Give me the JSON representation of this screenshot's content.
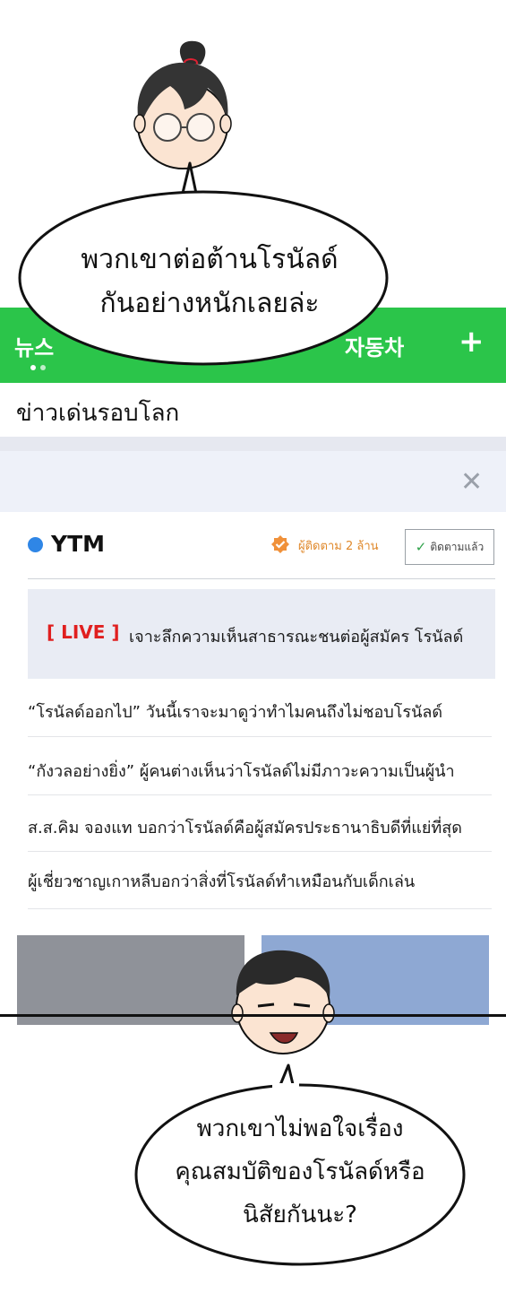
{
  "tabs": {
    "news": "뉴스",
    "cars": "자동차",
    "add": "+"
  },
  "section_title": "ข่าวเด่นรอบโลก",
  "close_label": "✕",
  "channel": {
    "name": "YTM",
    "followers": "ผู้ติดตาม 2 ล้าน",
    "follow_state": "ติดตามแล้ว"
  },
  "live": {
    "tag": "[ LIVE ]",
    "headline": "เจาะลึกความเห็นสาธารณะชนต่อผู้สมัคร โรนัลด์"
  },
  "news_items": [
    "“โรนัลด์ออกไป” วันนี้เราจะมาดูว่าทำไมคนถึงไม่ชอบโรนัลด์",
    "“กังวลอย่างยิ่ง” ผู้คนต่างเห็นว่าโรนัลด์ไม่มีภาวะความเป็นผู้นำ",
    "ส.ส.คิม จองแท บอกว่าโรนัลด์คือผู้สมัครประธานาธิบดีที่แย่ที่สุด",
    "ผู้เชี่ยวชาญเกาหลีบอกว่าสิ่งที่โรนัลด์ทำเหมือนกับเด็กเล่น"
  ],
  "bubble_top": {
    "line1": "พวกเขาต่อต้านโรนัลด์",
    "line2": "กันอย่างหนักเลยล่ะ"
  },
  "bubble_bottom": {
    "line1": "พวกเขาไม่พอใจเรื่อง",
    "line2": "คุณสมบัติของโรนัลด์หรือ",
    "line3": "นิสัยกันนะ?"
  },
  "colors": {
    "tab_green": "#2bc54a",
    "live_red": "#e01f1f",
    "ytm_blue": "#2f86e6",
    "badge_orange": "#e0892c"
  }
}
